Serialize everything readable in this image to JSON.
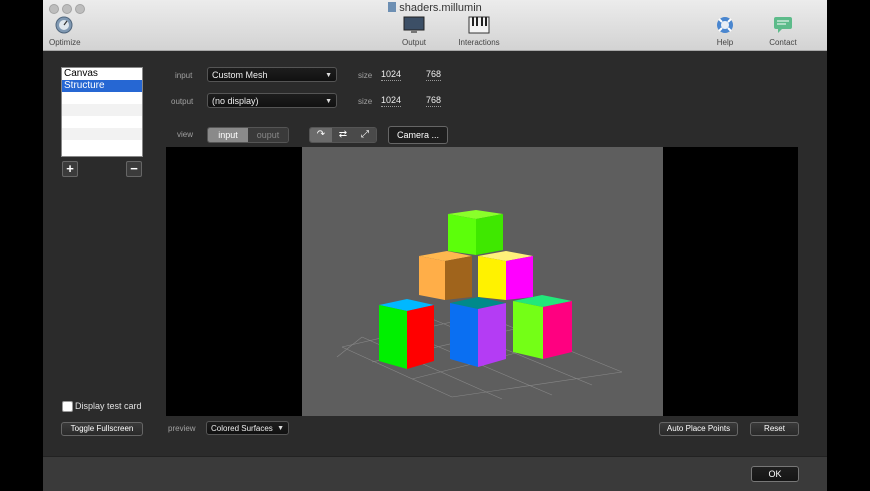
{
  "window": {
    "title": "shaders.millumin"
  },
  "toolbar": {
    "optimize": "Optimize",
    "output": "Output",
    "interactions": "Interactions",
    "help": "Help",
    "contact": "Contact"
  },
  "layers": {
    "items": [
      "Canvas",
      "Structure"
    ],
    "selected": "Structure",
    "add_label": "+",
    "remove_label": "−"
  },
  "io": {
    "input_label": "input",
    "input_value": "Custom Mesh",
    "output_label": "output",
    "output_value": "(no display)",
    "size_label": "size",
    "input_width": "1024",
    "input_height": "768",
    "output_width": "1024",
    "output_height": "768"
  },
  "view": {
    "label": "view",
    "tab_input": "input",
    "tab_output": "ouput",
    "active_tab": "input",
    "tool_icons": [
      "rotate-icon",
      "move-icon",
      "scale-icon"
    ],
    "camera_button": "Camera ..."
  },
  "bottom": {
    "display_test_card": "Display test card",
    "test_card_checked": false,
    "toggle_fullscreen": "Toggle Fullscreen",
    "preview_label": "preview",
    "preview_value": "Colored Surfaces",
    "auto_place_points": "Auto Place Points",
    "reset": "Reset",
    "ok": "OK"
  },
  "colors": {
    "window_bg": "#2b2b2b",
    "selection": "#2667d3",
    "scene_bg": "#5e5e5e"
  }
}
